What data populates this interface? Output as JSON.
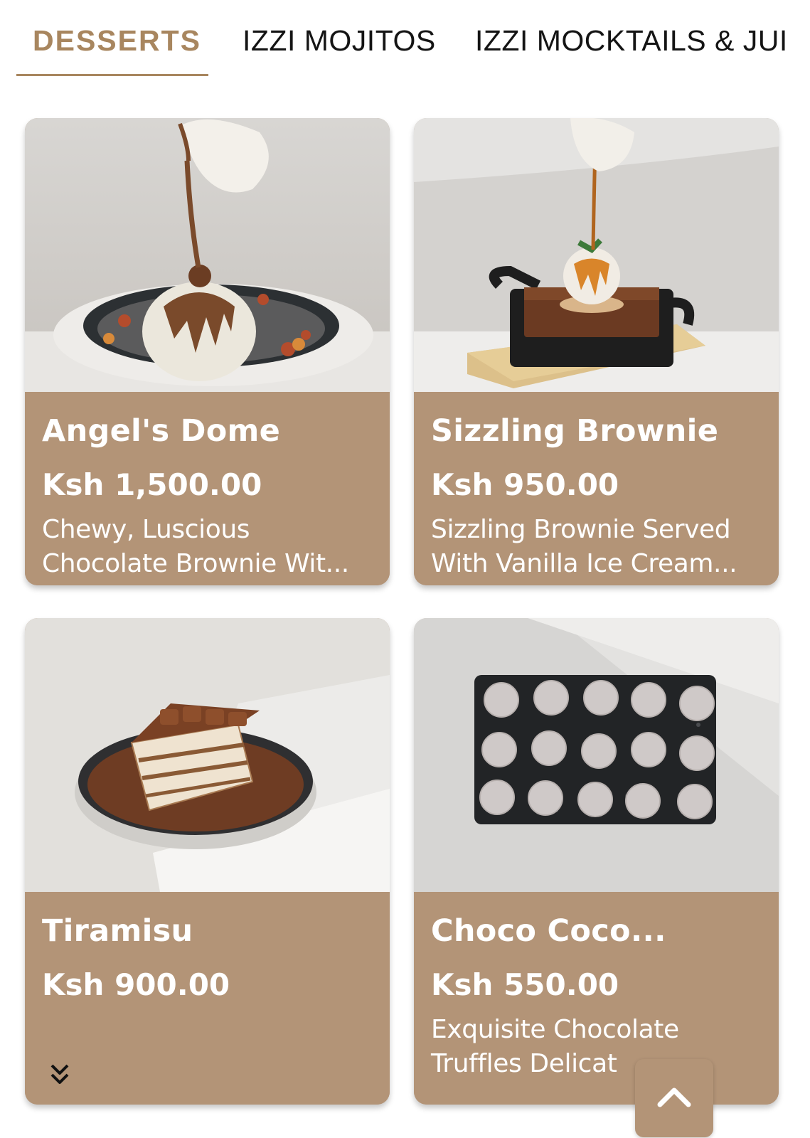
{
  "tabs": [
    {
      "label": "DESSERTS",
      "active": true
    },
    {
      "label": "IZZI MOJITOS",
      "active": false
    },
    {
      "label": "IZZI MOCKTAILS & JUI",
      "active": false
    }
  ],
  "colors": {
    "accent": "#a8865f",
    "card_background": "#b39477",
    "card_text": "#ffffff"
  },
  "products": [
    {
      "name": "Angel's Dome",
      "price": "Ksh 1,500.00",
      "description_line1": "Chewy, Luscious",
      "description_line2": "Chocolate Brownie Wit..."
    },
    {
      "name": "Sizzling Brownie",
      "price": "Ksh 950.00",
      "description_line1": "Sizzling Brownie Served",
      "description_line2": "With Vanilla Ice Cream..."
    },
    {
      "name": "Tiramisu",
      "price": "Ksh 900.00",
      "description_line1": "",
      "description_line2": ""
    },
    {
      "name": "Choco Coco...",
      "price": "Ksh 550.00",
      "description_line1": "Exquisite Chocolate",
      "description_line2": "Truffles Delicat"
    }
  ],
  "icons": {
    "expand": "double-chevron-down-icon",
    "scroll_top": "chevron-up-icon"
  }
}
